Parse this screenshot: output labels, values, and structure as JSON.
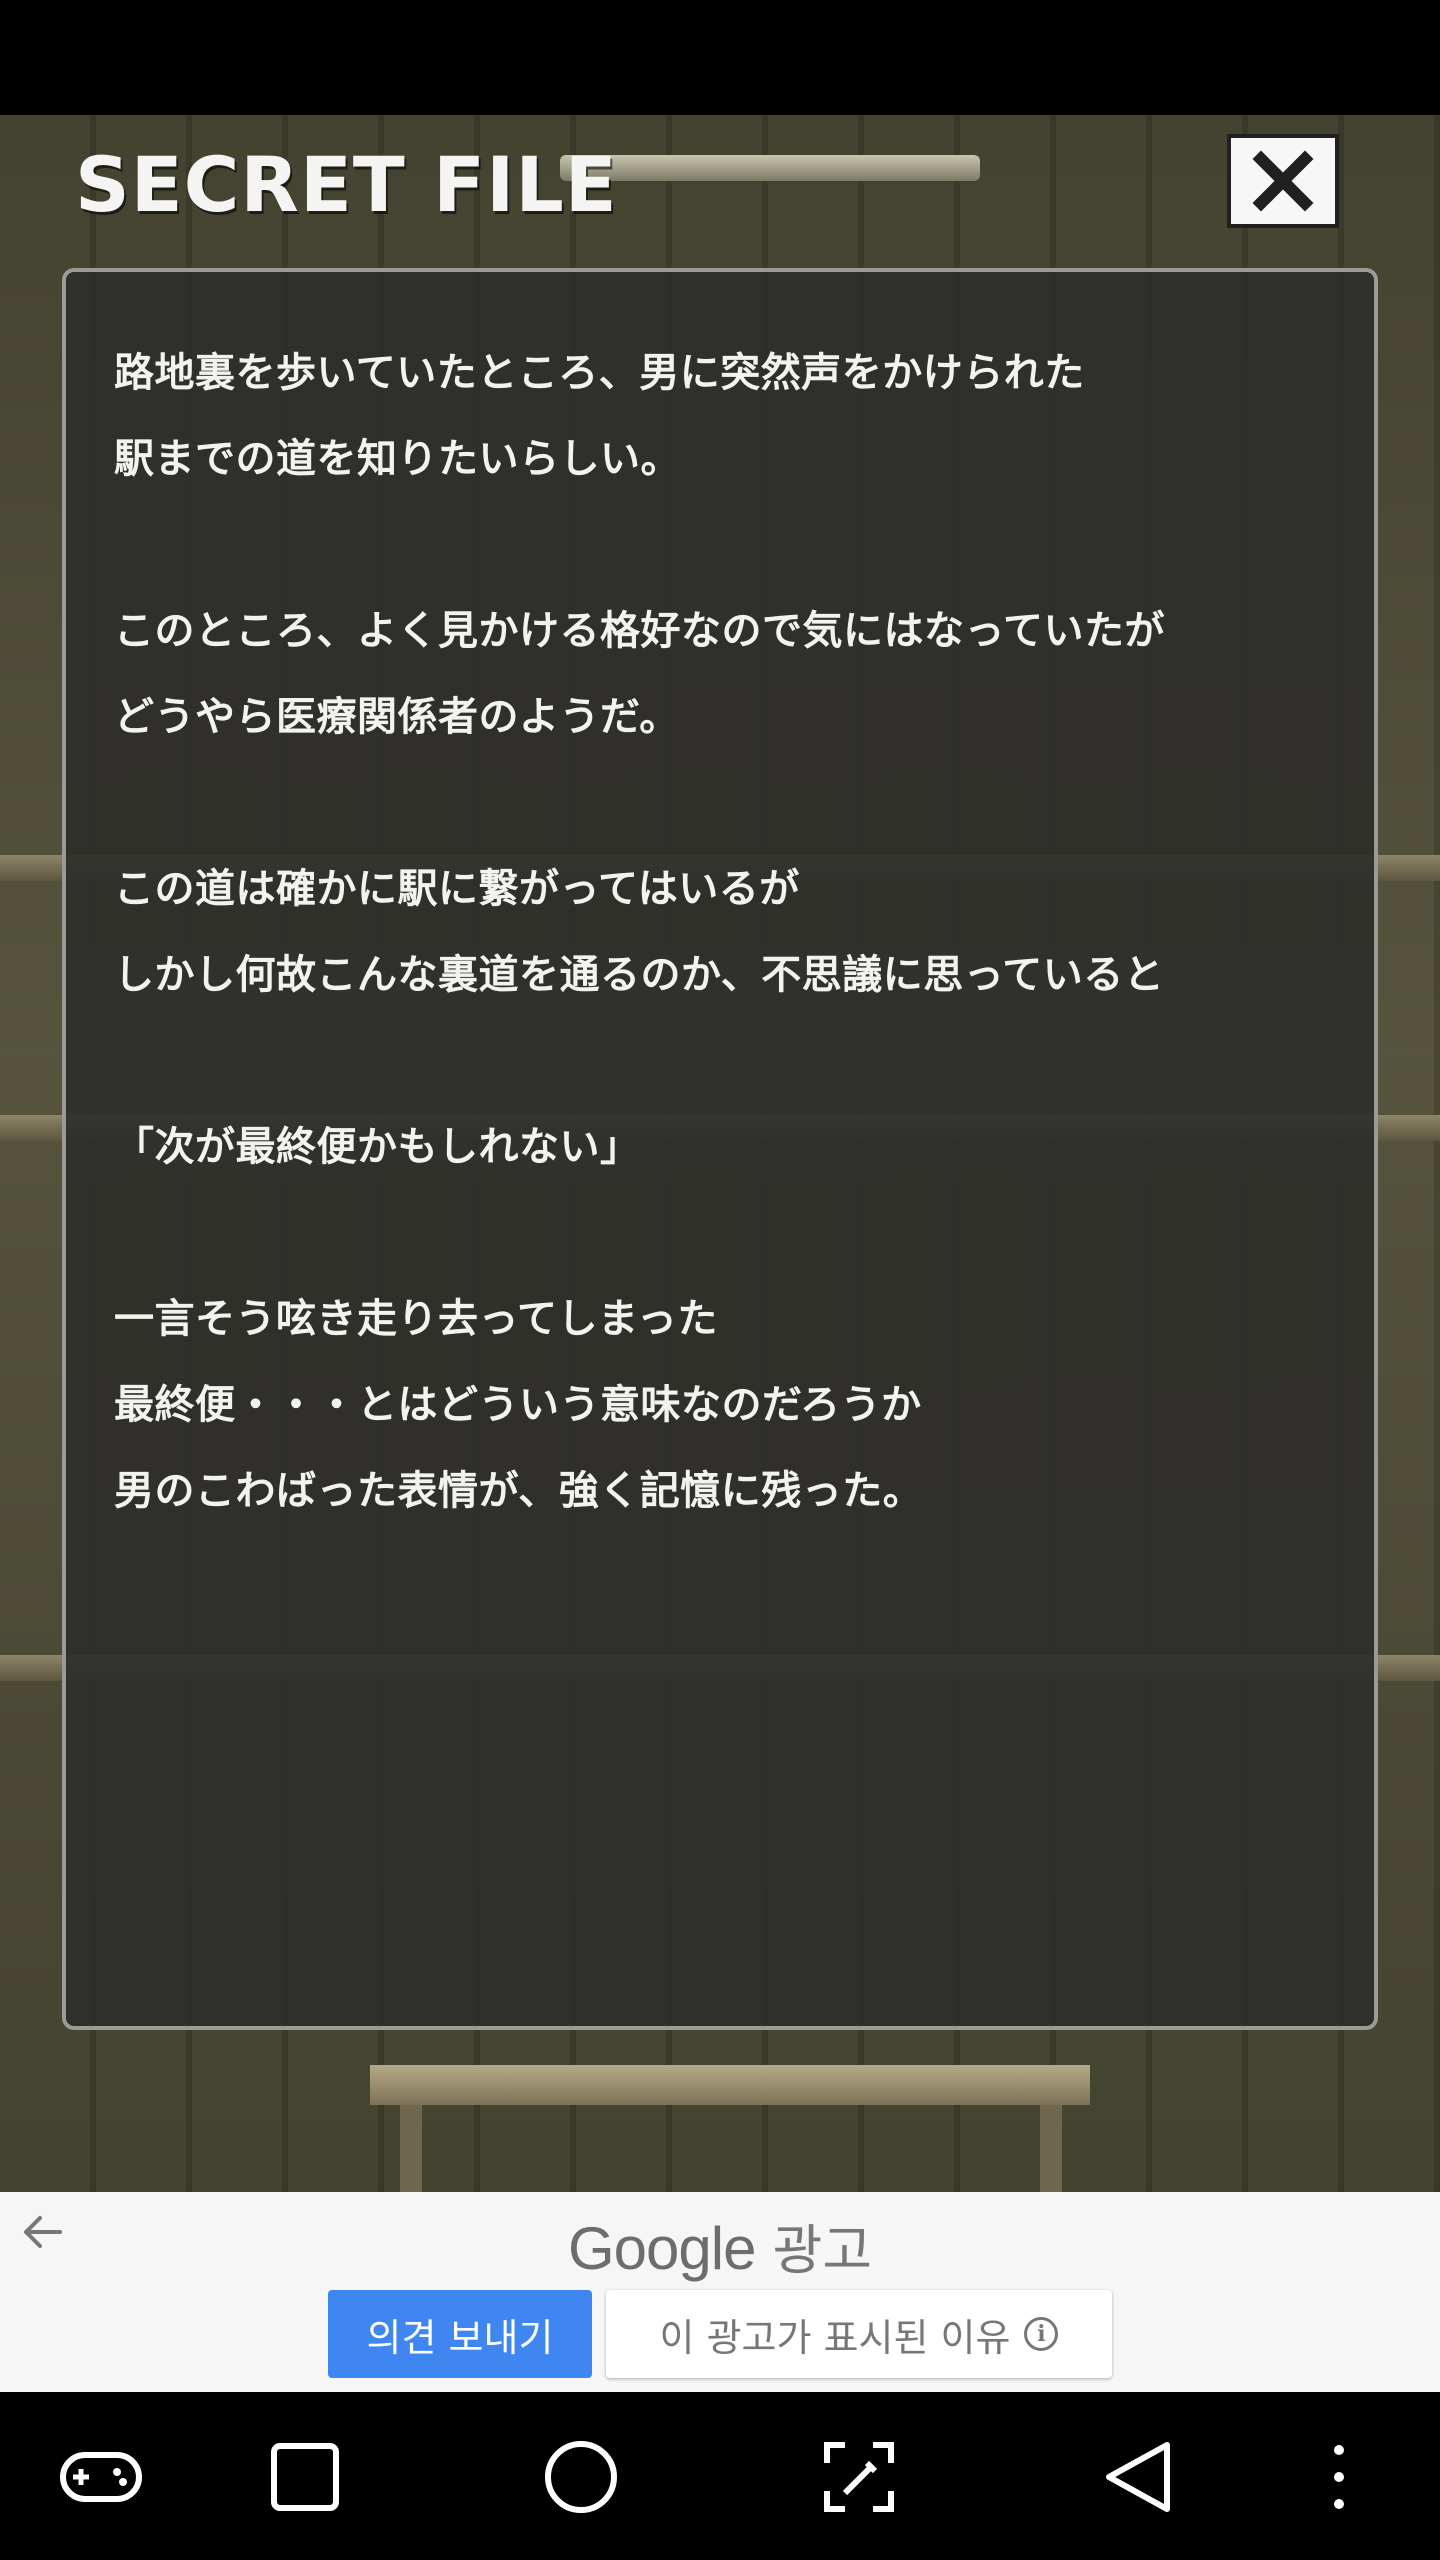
{
  "game": {
    "title": "SECRET FILE",
    "story_lines": [
      "路地裏を歩いていたところ、男に突然声をかけられた",
      "駅までの道を知りたいらしい。",
      "",
      "このところ、よく見かける格好なので気にはなっていたが",
      "どうやら医療関係者のようだ。",
      "",
      "この道は確かに駅に繋がってはいるが",
      "しかし何故こんな裏道を通るのか、不思議に思っていると",
      "",
      "「次が最終便かもしれない」",
      "",
      "一言そう呟き走り去ってしまった",
      "最終便・・・とはどういう意味なのだろうか",
      "男のこわばった表情が、強く記憶に残った。"
    ]
  },
  "ad": {
    "brand_google": "Google",
    "brand_suffix": "광고",
    "feedback_label": "의견 보내기",
    "why_label": "이 광고가 표시된 이유"
  },
  "icons": {
    "close": "close-icon",
    "back": "back-arrow-icon",
    "info": "info-icon",
    "nav": [
      "gamepad-icon",
      "recents-icon",
      "home-icon",
      "screenshot-icon",
      "back-icon",
      "more-icon"
    ]
  },
  "colors": {
    "panel_bg": "#2c2c2a",
    "text": "#f2f2ee",
    "ad_button": "#3f86f0"
  }
}
